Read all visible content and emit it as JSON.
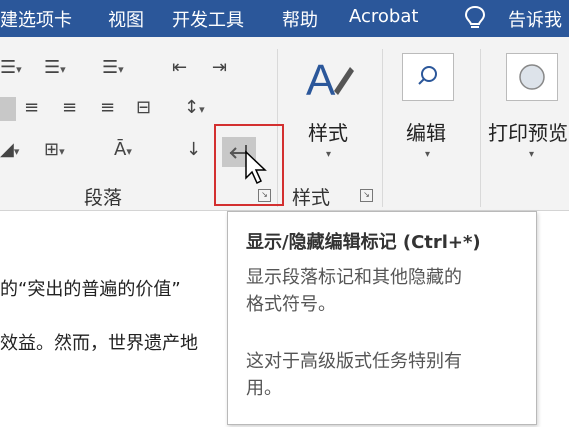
{
  "menu": [
    "建选项卡",
    "视图",
    "开发工具",
    "帮助",
    "Acrobat",
    "告诉我"
  ],
  "paragraph_group": {
    "label": "段落"
  },
  "styles_group": {
    "button_label": "样式",
    "label": "样式"
  },
  "edit_button": {
    "label": "编辑"
  },
  "print_preview_button": {
    "label": "打印预览"
  },
  "tooltip": {
    "title": "显示/隐藏编辑标记 (Ctrl+*)",
    "line1": "显示段落标记和其他隐藏的",
    "line2": "格式符号。",
    "line3": "这对于高级版式任务特别有",
    "line4": "用。"
  },
  "document": {
    "line1": "的“突出的普遍的价值”",
    "line2": "效益。然而，世界遗产地"
  },
  "colors": {
    "titlebar": "#2b579a",
    "highlight_border": "#d32f2f",
    "selected_button": "#c8c8c8"
  },
  "icons": [
    "bulleted-list",
    "numbered-list",
    "multilevel-list",
    "decrease-indent",
    "increase-indent",
    "align-left",
    "center",
    "align-right",
    "justify",
    "distributed",
    "line-spacing",
    "shading",
    "borders",
    "asian-layout",
    "sort",
    "show-hide-marks",
    "styles-brush",
    "find",
    "print-preview",
    "lightbulb",
    "mouse-pointer"
  ]
}
